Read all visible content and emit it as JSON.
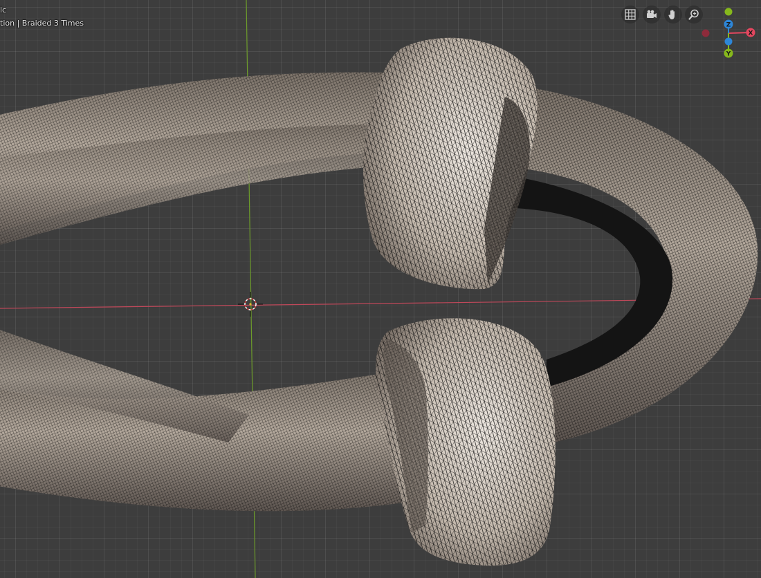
{
  "viewport": {
    "view_label": "ic",
    "object_label": "tion | Braided 3 Times"
  },
  "nav": [
    {
      "name": "toggle-grid-button",
      "icon": "grid-icon"
    },
    {
      "name": "camera-view-button",
      "icon": "camera-icon"
    },
    {
      "name": "pan-view-button",
      "icon": "hand-icon"
    },
    {
      "name": "zoom-view-button",
      "icon": "zoom-icon"
    }
  ],
  "gizmo": {
    "x_label": "X",
    "y_label": "Y",
    "z_label": "Z",
    "colors": {
      "x": "#e4475f",
      "y": "#86b81c",
      "z": "#2d86d8",
      "neg_x": "#8e2b3b"
    }
  },
  "colors": {
    "background": "#3d3d3d",
    "x_axis": "#c0485a",
    "y_axis": "#6d9c2b",
    "mesh": "#a99f93"
  }
}
